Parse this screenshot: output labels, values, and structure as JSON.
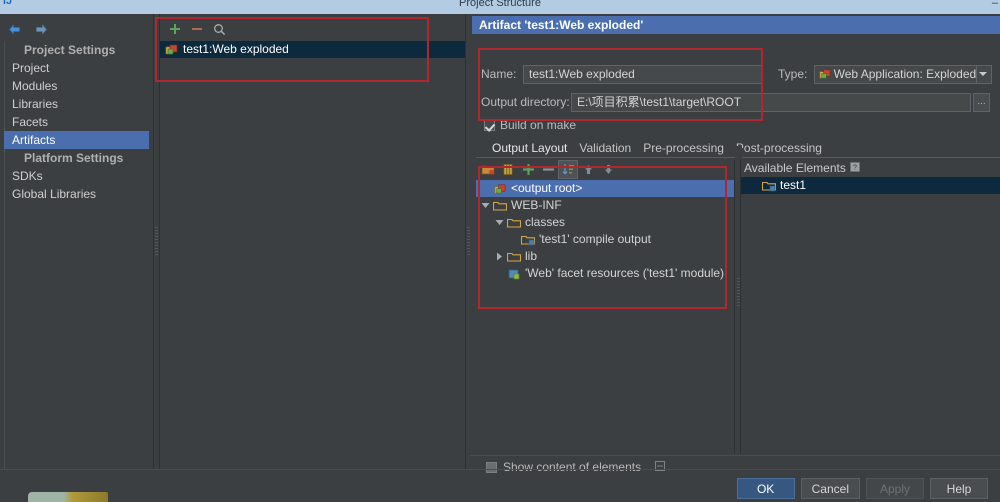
{
  "window": {
    "title": "Project Structure",
    "logo_icon": "intellij-logo-icon",
    "right_corner": "–"
  },
  "sidebar": {
    "back_icon": "back-arrow-icon",
    "forward_icon": "forward-arrow-icon",
    "groups": [
      {
        "label": "Project Settings",
        "items": [
          {
            "label": "Project",
            "selected": false
          },
          {
            "label": "Modules",
            "selected": false
          },
          {
            "label": "Libraries",
            "selected": false
          },
          {
            "label": "Facets",
            "selected": false
          },
          {
            "label": "Artifacts",
            "selected": true
          }
        ]
      },
      {
        "label": "Platform Settings",
        "items": [
          {
            "label": "SDKs",
            "selected": false
          },
          {
            "label": "Global Libraries",
            "selected": false
          }
        ]
      }
    ]
  },
  "artifact_panel": {
    "toolbar": [
      {
        "name": "add-artifact-button",
        "icon": "plus-icon",
        "title": "+"
      },
      {
        "name": "remove-artifact-button",
        "icon": "minus-icon",
        "title": "−"
      },
      {
        "name": "find-artifact-button",
        "icon": "search-icon",
        "title": "search"
      }
    ],
    "items": [
      {
        "label": "test1:Web exploded",
        "icon": "web-exploded-artifact-icon",
        "selected": true
      }
    ]
  },
  "details": {
    "header": "Artifact 'test1:Web exploded'",
    "name_label": "Name:",
    "name_value": "test1:Web exploded",
    "type_label": "Type:",
    "type_value": "Web Application: Exploded",
    "type_icon": "web-exploded-artifact-icon",
    "type_dropdown_icon": "chevron-down-icon",
    "output_dir_label": "Output directory:",
    "output_dir_value": "E:\\项目积累\\test1\\target\\ROOT",
    "browse_label": "...",
    "build_on_make_label": "Build on make",
    "build_on_make_checked": true,
    "tabs": [
      {
        "label": "Output Layout",
        "active": true
      },
      {
        "label": "Validation",
        "active": false
      },
      {
        "label": "Pre-processing",
        "active": false
      },
      {
        "label": "Post-processing",
        "active": false
      }
    ],
    "layout_toolbar": [
      {
        "name": "create-directory-button",
        "icon": "new-folder-icon"
      },
      {
        "name": "create-archive-button",
        "icon": "archive-icon"
      },
      {
        "name": "add-copy-of-button",
        "icon": "plus-icon"
      },
      {
        "name": "remove-element-button",
        "icon": "minus-icon"
      },
      {
        "name": "sort-elements-button",
        "icon": "sort-icon",
        "active": true
      },
      {
        "name": "move-up-button",
        "icon": "arrow-up-icon"
      },
      {
        "name": "move-down-button",
        "icon": "arrow-down-icon"
      }
    ],
    "tree": [
      {
        "label": "<output root>",
        "indent": 0,
        "icon": "output-root-icon",
        "twisty": "none",
        "selected": "blue"
      },
      {
        "label": "WEB-INF",
        "indent": 0,
        "icon": "folder-icon",
        "twisty": "expanded",
        "selected": "none"
      },
      {
        "label": "classes",
        "indent": 1,
        "icon": "folder-icon",
        "twisty": "expanded",
        "selected": "none"
      },
      {
        "label": "'test1' compile output",
        "indent": 2,
        "icon": "compile-output-icon",
        "twisty": "none",
        "selected": "none"
      },
      {
        "label": "lib",
        "indent": 1,
        "icon": "folder-icon",
        "twisty": "collapsed",
        "selected": "none"
      },
      {
        "label": "'Web' facet resources ('test1' module)",
        "indent": 1,
        "icon": "facet-resources-icon",
        "twisty": "none",
        "selected": "none"
      }
    ],
    "available_title": "Available Elements",
    "available_help_icon": "help-icon",
    "available_items": [
      {
        "label": "test1",
        "icon": "module-output-icon",
        "selected": true
      }
    ],
    "show_content_label": "Show content of elements",
    "show_content_checked": false,
    "show_content_extra_icon": "expand-icon"
  },
  "buttons": {
    "ok": "OK",
    "cancel": "Cancel",
    "apply": "Apply",
    "help": "Help"
  },
  "colors": {
    "accent_blue": "#4b6eaf",
    "selection_navy": "#0d293e",
    "annotation_red": "#b0272d",
    "background": "#3c3f41",
    "titlebar": "#b3cce4",
    "primary_button": "#365880"
  }
}
